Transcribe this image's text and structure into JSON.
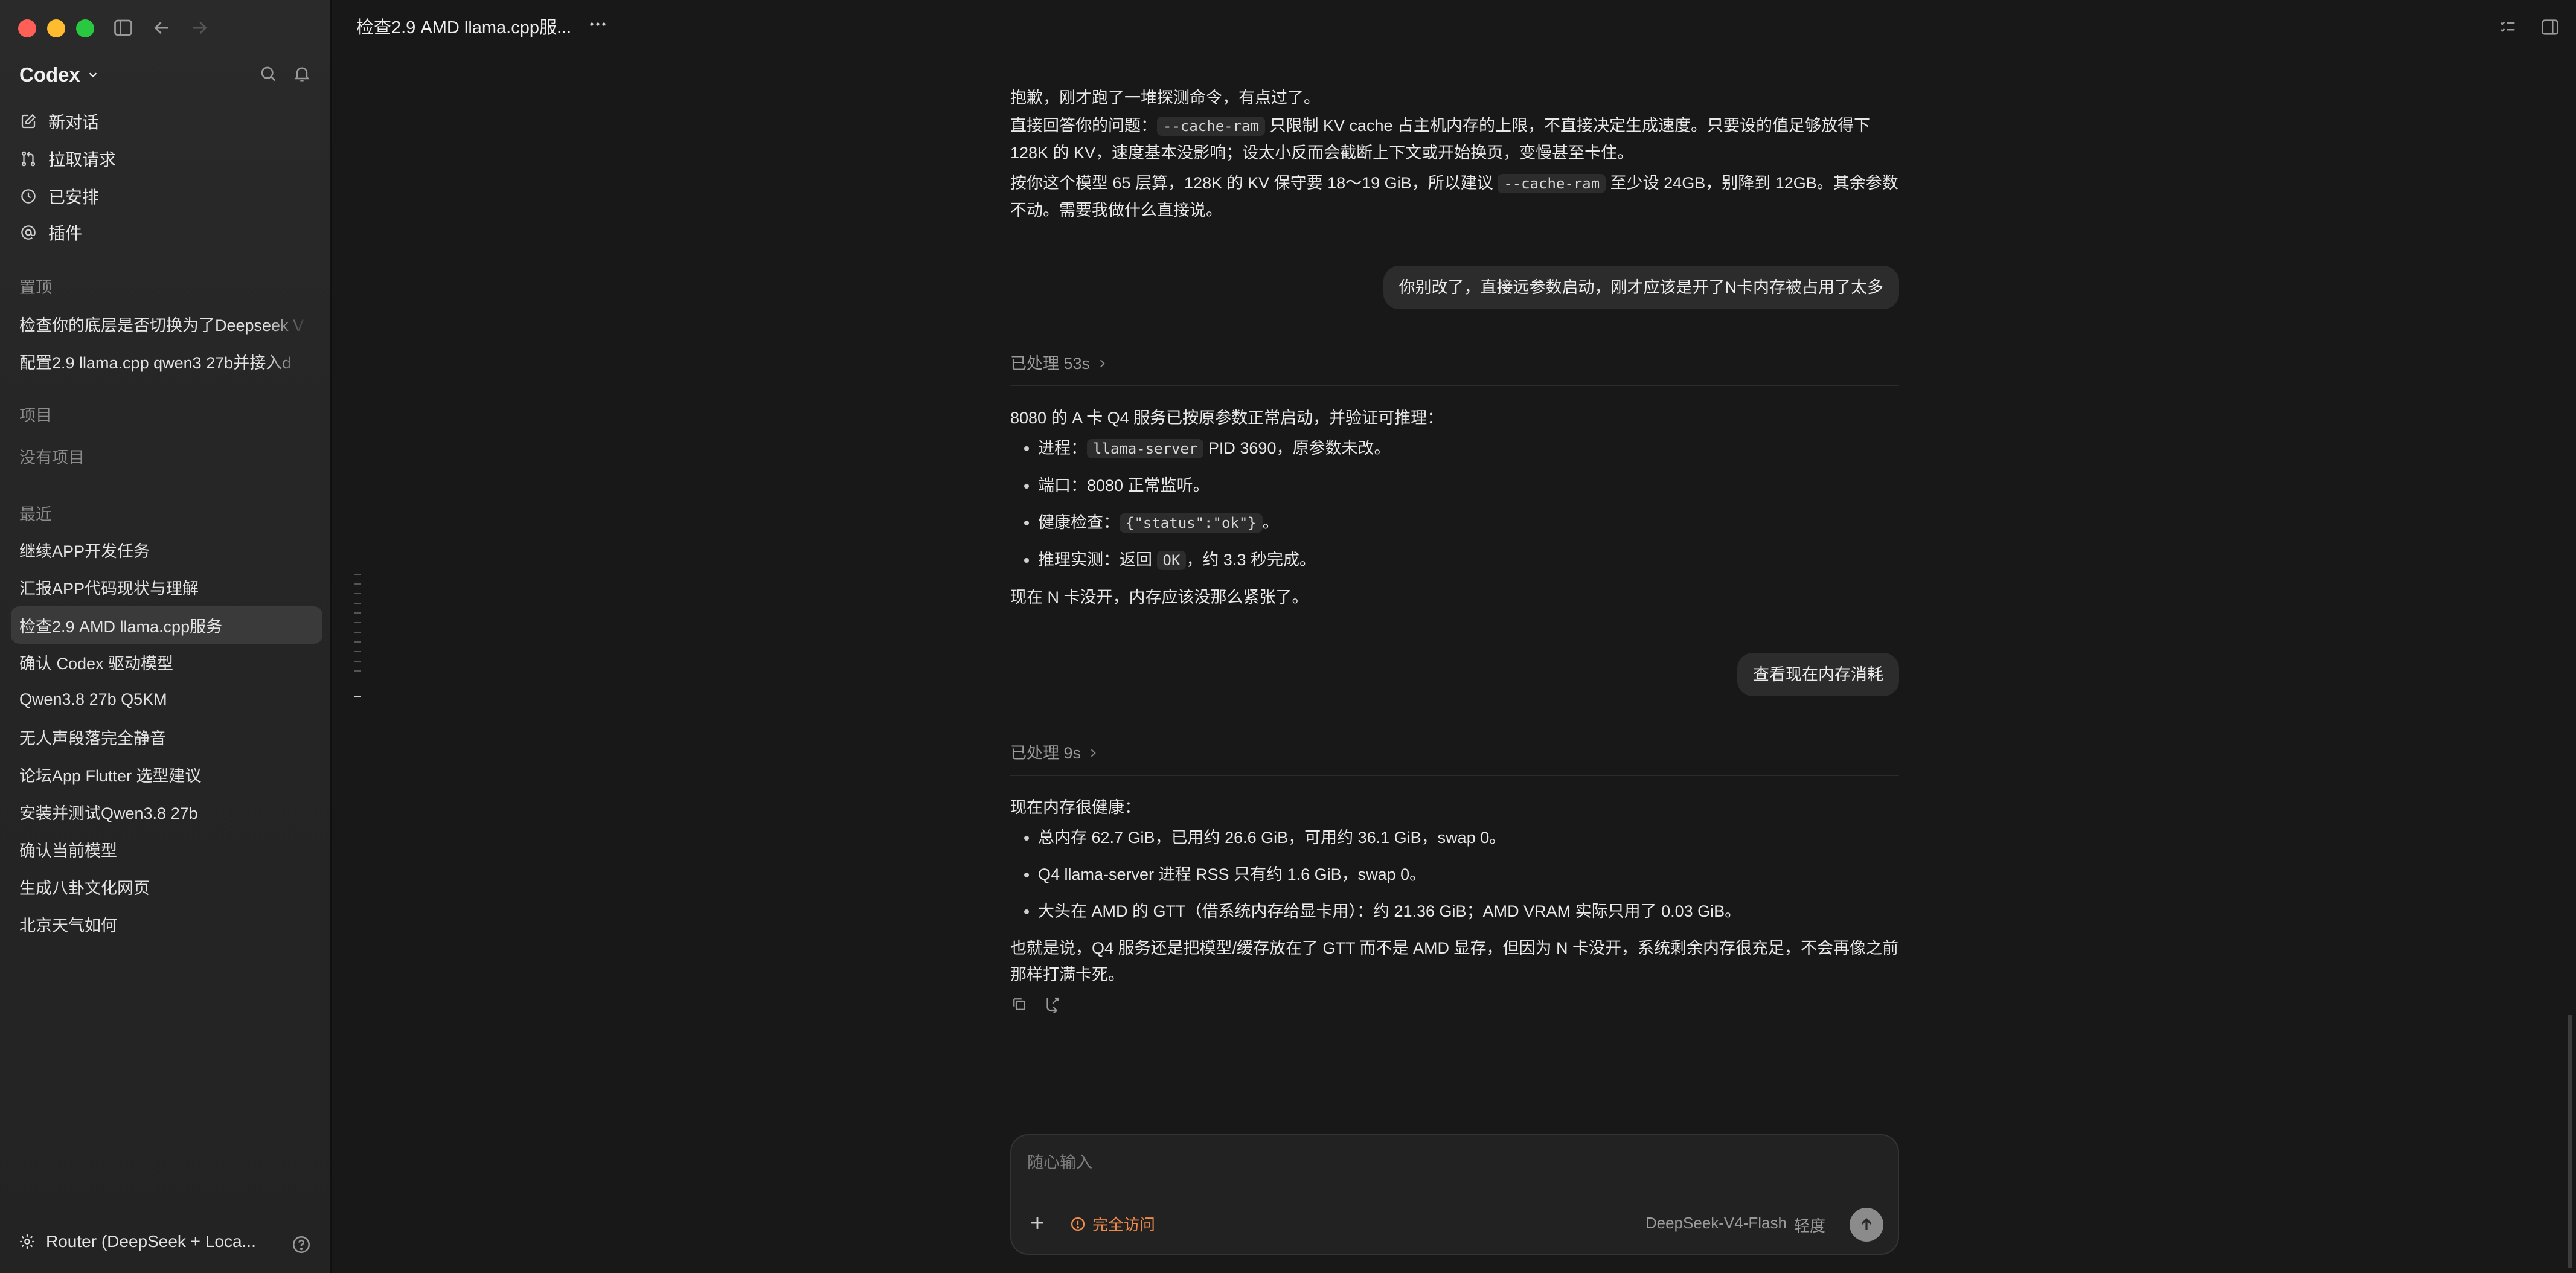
{
  "window": {
    "conversation_title": "检查2.9 AMD llama.cpp服...",
    "more_label": "···"
  },
  "sidebar": {
    "brand": "Codex",
    "nav": [
      {
        "label": "新对话",
        "icon": "compose-icon"
      },
      {
        "label": "拉取请求",
        "icon": "pull-request-icon"
      },
      {
        "label": "已安排",
        "icon": "clock-icon"
      },
      {
        "label": "插件",
        "icon": "at-icon"
      }
    ],
    "pinned_header": "置顶",
    "pinned": [
      "检查你的底层是否切换为了Deepseek V",
      "配置2.9 llama.cpp qwen3 27b并接入d"
    ],
    "projects_header": "项目",
    "no_projects": "没有项目",
    "recent_header": "最近",
    "recent": [
      "继续APP开发任务",
      "汇报APP代码现状与理解",
      "检查2.9 AMD llama.cpp服务",
      "确认 Codex 驱动模型",
      "Qwen3.8 27b Q5KM",
      "无人声段落完全静音",
      "论坛App Flutter 选型建议",
      "安装并测试Qwen3.8 27b",
      "确认当前模型",
      "生成八卦文化网页",
      "北京天气如何"
    ],
    "active_index": 2,
    "footer_label": "Router (DeepSeek + Loca..."
  },
  "messages": {
    "a1": {
      "p1": "抱歉，刚才跑了一堆探测命令，有点过了。",
      "p2_pre": "直接回答你的问题：",
      "p2_code": "--cache-ram",
      "p2_post": " 只限制 KV cache 占主机内存的上限，不直接决定生成速度。只要设的值足够放得下 128K 的 KV，速度基本没影响；设太小反而会截断上下文或开始换页，变慢甚至卡住。",
      "p3_pre": "按你这个模型 65 层算，128K 的 KV 保守要 18～19 GiB，所以建议 ",
      "p3_code": "--cache-ram",
      "p3_post": " 至少设 24GB，别降到 12GB。其余参数不动。需要我做什么直接说。"
    },
    "u1": "你别改了，直接远参数启动，刚才应该是开了N卡内存被占用了太多",
    "proc1": "已处理 53s",
    "a2": {
      "intro": "8080 的 A 卡 Q4 服务已按原参数正常启动，并验证可推理：",
      "b1_pre": "进程：",
      "b1_code": "llama-server",
      "b1_post": " PID 3690，原参数未改。",
      "b2": "端口：8080 正常监听。",
      "b3_pre": "健康检查：",
      "b3_code": "{\"status\":\"ok\"}",
      "b3_post": "。",
      "b4_pre": "推理实测：返回 ",
      "b4_code": "OK",
      "b4_post": "，约 3.3 秒完成。",
      "outro": "现在 N 卡没开，内存应该没那么紧张了。"
    },
    "u2": "查看现在内存消耗",
    "proc2": "已处理 9s",
    "a3": {
      "intro": "现在内存很健康：",
      "b1": "总内存 62.7 GiB，已用约 26.6 GiB，可用约 36.1 GiB，swap 0。",
      "b2": "Q4 llama-server 进程 RSS 只有约 1.6 GiB，swap 0。",
      "b3": "大头在 AMD 的 GTT（借系统内存给显卡用）：约 21.36 GiB；AMD VRAM 实际只用了 0.03 GiB。",
      "outro": "也就是说，Q4 服务还是把模型/缓存放在了 GTT 而不是 AMD 显存，但因为 N 卡没开，系统剩余内存很充足，不会再像之前那样打满卡死。"
    }
  },
  "composer": {
    "placeholder": "随心输入",
    "access_label": "完全访问",
    "model_label": "DeepSeek-V4-Flash",
    "effort_label": "轻度"
  },
  "colors": {
    "background": "#181818",
    "sidebar": "#262626",
    "bubble": "#2c2c2c",
    "access": "#f08a4b"
  }
}
